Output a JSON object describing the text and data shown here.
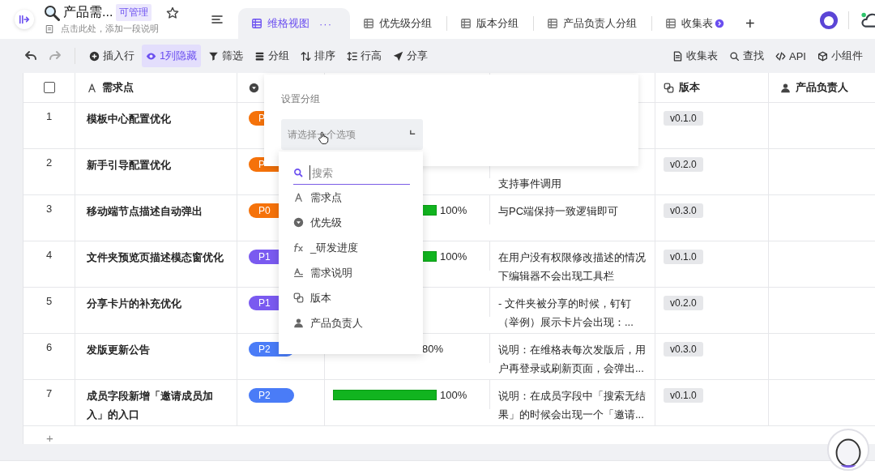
{
  "header": {
    "title": "产品需...",
    "permission": "可管理",
    "description_placeholder": "点击此处，添加一段说明"
  },
  "tabs": [
    {
      "label": "维格视图",
      "selected": true,
      "more": "···"
    },
    {
      "label": "优先级分组",
      "selected": false
    },
    {
      "label": "版本分组",
      "selected": false
    },
    {
      "label": "产品负责人分组",
      "selected": false
    },
    {
      "label": "收集表",
      "selected": false
    }
  ],
  "add_tab": "+",
  "toolbar": {
    "left": [
      {
        "label": "插入行",
        "kind": "insert",
        "active": false
      },
      {
        "label": "1列隐藏",
        "kind": "hide",
        "active": true
      },
      {
        "label": "筛选",
        "kind": "filter",
        "active": false
      },
      {
        "label": "分组",
        "kind": "group",
        "active": false
      },
      {
        "label": "排序",
        "kind": "sort",
        "active": false
      },
      {
        "label": "行高",
        "kind": "row_height",
        "active": false
      },
      {
        "label": "分享",
        "kind": "share",
        "active": false
      }
    ],
    "right": [
      {
        "label": "收集表",
        "kind": "form"
      },
      {
        "label": "查找",
        "kind": "search"
      },
      {
        "label": "API",
        "kind": "api"
      },
      {
        "label": "小组件",
        "kind": "widget"
      }
    ]
  },
  "table": {
    "select_all": {
      "checked": false
    },
    "columns": [
      {
        "label": "需求点",
        "kind": "text"
      },
      {
        "kind": "single_select"
      },
      {
        "label": "版本",
        "kind": "link"
      },
      {
        "label": "产品负责人",
        "kind": "member"
      }
    ],
    "rows": [
      {
        "index": "1",
        "name": [
          "模板中心配置优化"
        ],
        "priority": {
          "label": "P",
          "color": "#f5720a"
        },
        "version": "v0.1.0"
      },
      {
        "index": "2",
        "name": [
          "新手引导配置优化"
        ],
        "priority": {
          "label": "P",
          "color": "#f5720a"
        },
        "description": [
          "支持事件调用"
        ],
        "description_first_line_hidden": true,
        "version": "v0.2.0"
      },
      {
        "index": "3",
        "name": [
          "移动端节点描述自动弹出"
        ],
        "priority": {
          "label": "P0",
          "color": "#f5720a"
        },
        "progress": {
          "level": 1,
          "reading": "100%"
        },
        "description": [
          "与PC端保持一致逻辑即可"
        ],
        "version": "v0.3.0"
      },
      {
        "index": "4",
        "name": [
          "文件夹预览页描述模态窗优化"
        ],
        "priority": {
          "label": "P1",
          "color": "#7a5af0"
        },
        "progress": {
          "level": 1,
          "reading": "100%"
        },
        "description": [
          "在用户没有权限修改描述的情况",
          "下编辑器不会出现工具栏"
        ],
        "version": "v0.1.0"
      },
      {
        "index": "5",
        "name": [
          "分享卡片的补充优化"
        ],
        "priority": {
          "label": "P1",
          "color": "#7a5af0"
        },
        "description": [
          "- 文件夹被分享的时候，钉钉",
          "（举例）展示卡片会出现：..."
        ],
        "version": "v0.2.0"
      },
      {
        "index": "6",
        "name": [
          "发版更新公告"
        ],
        "priority": {
          "label": "P2",
          "color": "#4a7cf7"
        },
        "progress": {
          "reading": "80%"
        },
        "description": [
          "说明：在维格表每次发版后，用",
          "户再登录或刷新页面，会弹出..."
        ],
        "version": "v0.3.0"
      },
      {
        "index": "7",
        "name": [
          "成员字段新增「邀请成员加",
          "入」的入口"
        ],
        "priority": {
          "label": "P2",
          "color": "#4a7cf7"
        },
        "progress": {
          "level": 1,
          "reading": "100%"
        },
        "description": [
          "说明：在成员字段中「搜索无结",
          "果」的时候会出现一个「邀请..."
        ],
        "version": "v0.1.0"
      }
    ],
    "add_row": "+"
  },
  "group_panel": {
    "title": "设置分组",
    "select_placeholder": "请选择一个选项",
    "search_placeholder": "搜索",
    "fields": [
      {
        "label": "需求点",
        "kind": "text"
      },
      {
        "label": "优先级",
        "kind": "single_select"
      },
      {
        "label": "_研发进度",
        "kind": "formula"
      },
      {
        "label": "需求说明",
        "kind": "long_text"
      },
      {
        "label": "版本",
        "kind": "link"
      },
      {
        "label": "产品负责人",
        "kind": "member"
      }
    ]
  }
}
